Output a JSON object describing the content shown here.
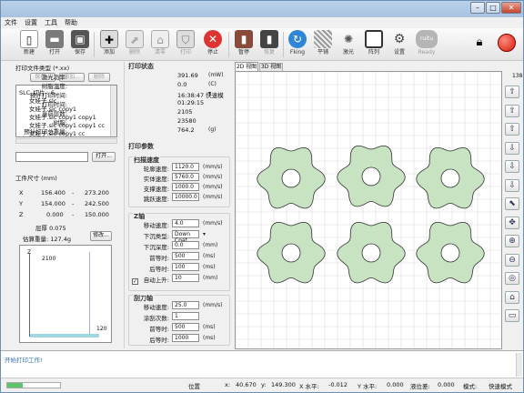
{
  "menu": [
    "文件",
    "设置",
    "工具",
    "帮助"
  ],
  "toolbar": [
    {
      "label": "新建",
      "icon": "new-file-icon",
      "enabled": true
    },
    {
      "label": "打开",
      "icon": "open-folder-icon",
      "enabled": true
    },
    {
      "label": "保存",
      "icon": "save-disk-icon",
      "enabled": true
    },
    {
      "label": "添加",
      "icon": "add-icon",
      "enabled": true
    },
    {
      "label": "删除",
      "icon": "delete-icon",
      "enabled": false
    },
    {
      "label": "清零",
      "icon": "home-icon",
      "enabled": false
    },
    {
      "label": "打印",
      "icon": "print-shield-icon",
      "enabled": false
    },
    {
      "label": "停止",
      "icon": "stop-icon",
      "enabled": true
    },
    {
      "label": "暂停",
      "icon": "pause-icon",
      "enabled": true
    },
    {
      "label": "恢复",
      "icon": "resume-icon",
      "enabled": false
    },
    {
      "label": "Fking",
      "icon": "refresh-icon",
      "enabled": true
    },
    {
      "label": "平铺",
      "icon": "tile-icon",
      "enabled": true
    },
    {
      "label": "激光",
      "icon": "laser-icon",
      "enabled": true
    },
    {
      "label": "阵列",
      "icon": "array-icon",
      "enabled": true
    },
    {
      "label": "设置",
      "icon": "gear-icon",
      "enabled": true
    },
    {
      "label": "Ready",
      "icon": "ready-icon",
      "enabled": false
    }
  ],
  "left": {
    "file_type_title": "打印文件类型 (*.xx)",
    "btn_save": "保存...",
    "btn_add": "添加...",
    "btn_delete": "删除",
    "tree": [
      "SLC_切片 : 6",
      "女娃子.slc",
      "女娃子.slc copy1",
      "女娃子.slc copy1 copy1",
      "女娃子.slc copy1 copy1 cc",
      "女娃子.slc copy1 cc"
    ],
    "btn_open": "打开...",
    "size_title": "工件尺寸 (mm)",
    "x_label": "X",
    "x_min": "156.400",
    "x_max": "273.200",
    "y_label": "Y",
    "y_min": "154.000",
    "y_max": "242.500",
    "z_label": "Z",
    "z_min": "0.000",
    "z_max": "150.000",
    "layer_thickness": "层厚  0.075",
    "estimated_weight": "估算重量: 127.4g",
    "btn_modify": "修改...",
    "z_axis": "Z",
    "z_top": "2100",
    "z_bottom": "120"
  },
  "mid": {
    "print_status_title": "打印状态",
    "status_rows": [
      {
        "label": "激光功率:",
        "value": "391.69",
        "unit": "(mW)"
      },
      {
        "label": "树脂温度:",
        "value": "0.0",
        "unit": "(C)"
      },
      {
        "label": "预计打印时间:",
        "value": "16:38:47 快速模",
        "unit": "▾"
      },
      {
        "label": "打印时间:",
        "value": "01:29:15",
        "unit": ""
      },
      {
        "label": "当前层数:",
        "value": "2105",
        "unit": ""
      },
      {
        "label": "树脂:",
        "value": "23580",
        "unit": ""
      },
      {
        "label": "预计打印总重量:",
        "value": "764.2",
        "unit": "(g)"
      }
    ],
    "print_params_title": "打印参数",
    "fill_group": "扫描速度",
    "fill_rows": [
      {
        "label": "轮廓速度:",
        "value": "1120.0",
        "unit": "(mm/s)"
      },
      {
        "label": "实体速度:",
        "value": "5760.0",
        "unit": "(mm/s)"
      },
      {
        "label": "支撑速度:",
        "value": "1000.0",
        "unit": "(mm/s)"
      },
      {
        "label": "跳跃速度:",
        "value": "10000.0",
        "unit": "(mm/s)"
      }
    ],
    "z_group": "Z轴",
    "z_rows": [
      {
        "label": "移动速度:",
        "value": "4.0",
        "unit": "(mm/s)"
      },
      {
        "label": "下沉类型:",
        "value": "Down Coat",
        "unit": "▾"
      },
      {
        "label": "下沉深度:",
        "value": "0.0",
        "unit": "(mm)"
      },
      {
        "label": "前等时:",
        "value": "500",
        "unit": "(ms)"
      },
      {
        "label": "后等时:",
        "value": "100",
        "unit": "(ms)"
      },
      {
        "label": "自动上升:",
        "value": "10",
        "unit": "(mm)"
      }
    ],
    "auto_rise_checked": true,
    "scraper_group": "刮刀轴",
    "scraper_rows": [
      {
        "label": "移动速度:",
        "value": "25.0",
        "unit": "(mm/s)"
      },
      {
        "label": "涂刮次数:",
        "value": "1",
        "unit": ""
      },
      {
        "label": "前等时:",
        "value": "500",
        "unit": "(ms)"
      },
      {
        "label": "后等时:",
        "value": "1000",
        "unit": "(ms)"
      }
    ]
  },
  "view": {
    "tabs": [
      "2D 视图",
      "3D 视图"
    ],
    "active_tab": 0,
    "layer_number": "138"
  },
  "right_buttons": [
    "up-arrow-icon",
    "up-arrow-icon",
    "up-arrow-icon",
    "down-arrow-icon",
    "down-arrow-icon",
    "down-arrow-icon",
    "select-icon",
    "move-icon",
    "zoom-in-icon",
    "zoom-out-icon",
    "zoom-fit-icon",
    "home-icon",
    "screen-icon"
  ],
  "log": {
    "message": "开始打印工作!"
  },
  "statusbar": {
    "position_label": "位置",
    "x_label": "x:",
    "x_value": "40.670",
    "y_label": "y:",
    "y_value": "149.300",
    "xlevel_label": "X 水平:",
    "xlevel_value": "-0.012",
    "ylevel_label": "Y 水平:",
    "ylevel_value": "0.000",
    "liquid_label": "液位差:",
    "liquid_value": "0.000",
    "mode_label": "模式:",
    "mode_value": "快速模式"
  },
  "colors": {
    "part_fill": "#c7e3c2",
    "part_stroke": "#333333",
    "accent": "#3a7bd5"
  }
}
